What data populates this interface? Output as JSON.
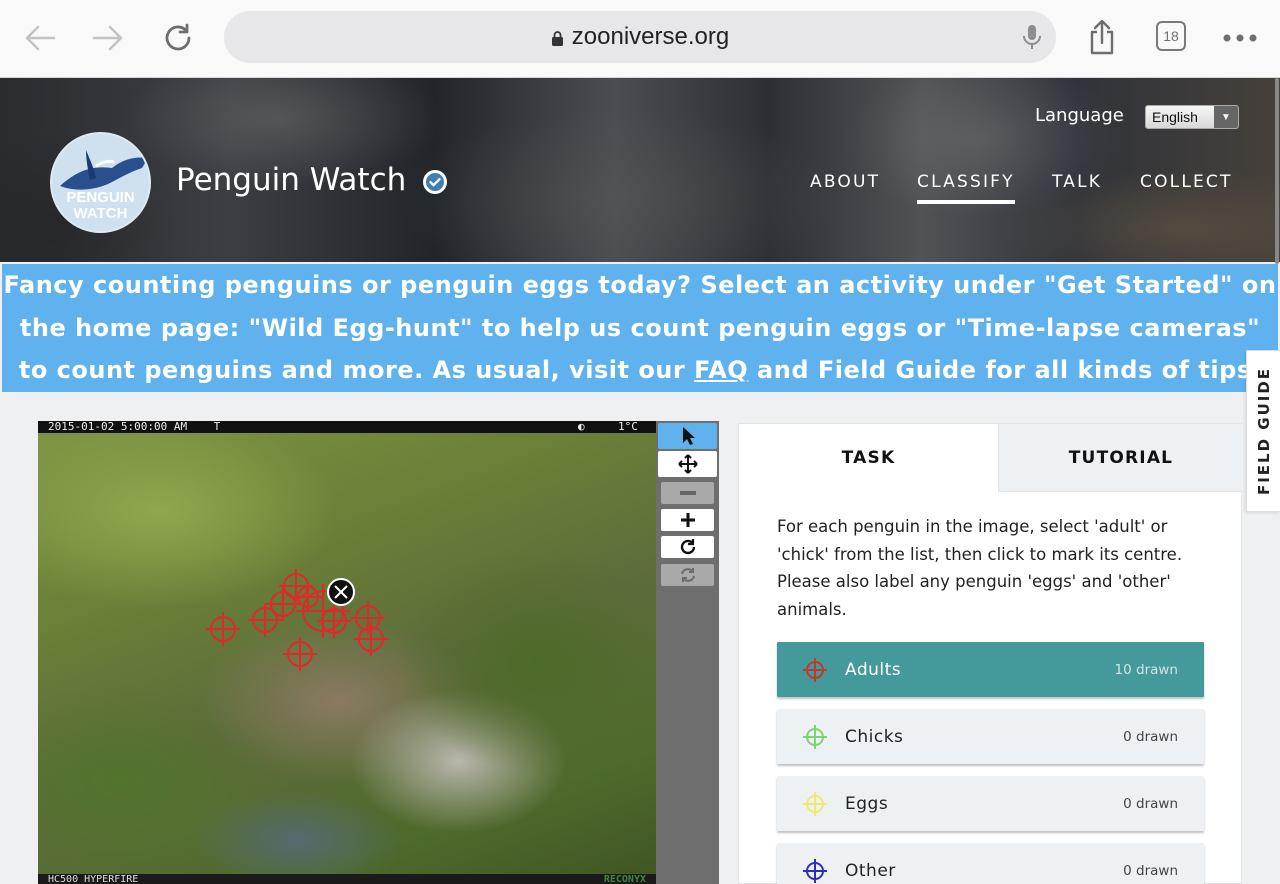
{
  "browser": {
    "url": "zooniverse.org",
    "tab_count": "18"
  },
  "header": {
    "logo_text_line1": "PENGUIN",
    "logo_text_line2": "WATCH",
    "project_title": "Penguin Watch",
    "language_label": "Language",
    "language_selected": "English",
    "nav": [
      "ABOUT",
      "CLASSIFY",
      "TALK",
      "COLLECT"
    ],
    "active_nav": "CLASSIFY"
  },
  "announcement": {
    "text_before": "Fancy counting penguins or penguin eggs today? Select an activity under \"Get Started\" on the home page: \"Wild Egg-hunt\" to help us count penguin eggs or \"Time-lapse cameras\" to count penguins and more. As usual, visit our ",
    "link": "FAQ",
    "text_after": " and Field Guide for all kinds of tips."
  },
  "subject": {
    "camera_timestamp": "2015-01-02 5:00:00 AM",
    "camera_t": "T",
    "camera_temp": "1°C",
    "camera_model": "HC500 HYPERFIRE",
    "camera_brand": "RECONYX",
    "mark_color": "#e02a2a"
  },
  "toolbar": {
    "tools": [
      "pointer-icon",
      "move-icon",
      "zoom-out-icon",
      "zoom-in-icon",
      "rotate-icon",
      "reset-icon"
    ]
  },
  "task_panel": {
    "tabs": [
      "TASK",
      "TUTORIAL"
    ],
    "instructions": "For each penguin in the image, select 'adult' or 'chick' from the list, then click to mark its centre. Please also label any penguin 'eggs' and 'other' animals.",
    "answers": [
      {
        "label": "Adults",
        "count": "10 drawn",
        "color": "#c0392b",
        "selected": true
      },
      {
        "label": "Chicks",
        "count": "0 drawn",
        "color": "#7ed46e",
        "selected": false
      },
      {
        "label": "Eggs",
        "count": "0 drawn",
        "color": "#ecec6a",
        "selected": false
      },
      {
        "label": "Other",
        "count": "0 drawn",
        "color": "#2b2fbf",
        "selected": false
      }
    ],
    "selected_bg": "#44999a"
  },
  "field_guide_label": "FIELD GUIDE"
}
